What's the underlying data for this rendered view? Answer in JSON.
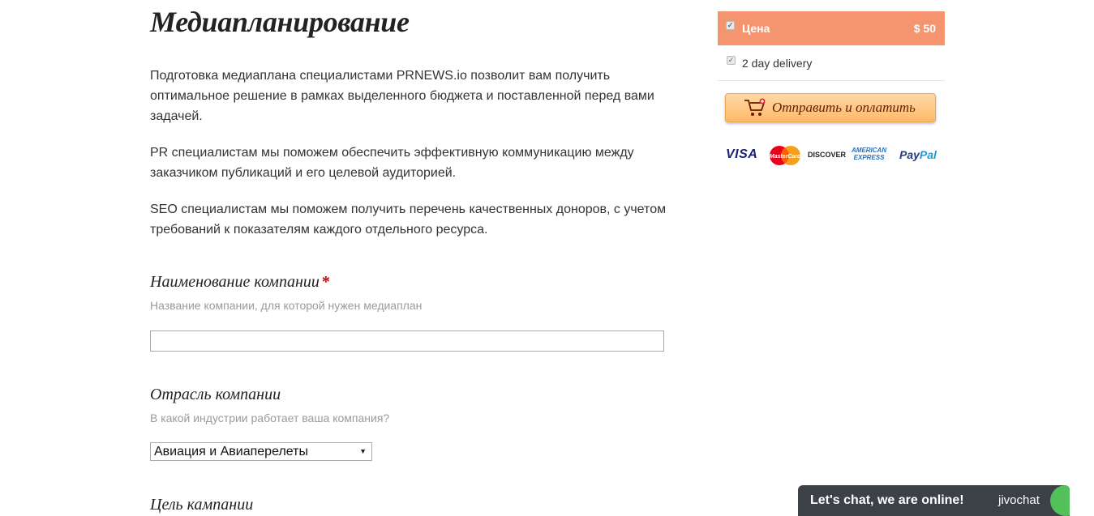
{
  "page": {
    "title": "Медиапланирование",
    "intro": [
      "Подготовка медиаплана специалистами PRNEWS.io позволит вам получить оптимальное решение в рамках выделенного бюджета и поставленной перед вами задачей.",
      "PR специалистам мы поможем обеспечить эффективную коммуникацию между заказчиком публикаций и его целевой аудиторией.",
      "SEO специалистам мы поможем получить перечень качественных доноров, с учетом требований к показателям каждого отдельного ресурса."
    ]
  },
  "form": {
    "company_name": {
      "label": "Наименование компании",
      "required_mark": "*",
      "hint": "Название компании, для которой нужен медиаплан",
      "value": ""
    },
    "industry": {
      "label": "Отрасль компании",
      "hint": "В какой индустрии работает ваша компания?",
      "selected": "Авиация и Авиаперелеты"
    },
    "goal": {
      "label": "Цель кампании"
    }
  },
  "sidebar": {
    "price": {
      "label": "Цена",
      "amount": "$ 50",
      "checked": true,
      "color": "#f5956f"
    },
    "delivery": {
      "label": "2 day delivery",
      "checked": true
    },
    "pay_button": {
      "label": "Отправить и оплатить",
      "icon": "cart-icon"
    },
    "payment_logos": [
      "VISA",
      "MasterCard",
      "DISCOVER",
      "AMERICAN EXPRESS",
      "PayPal"
    ]
  },
  "chat": {
    "label": "Let's chat, we are online!",
    "brand": "jivochat"
  }
}
